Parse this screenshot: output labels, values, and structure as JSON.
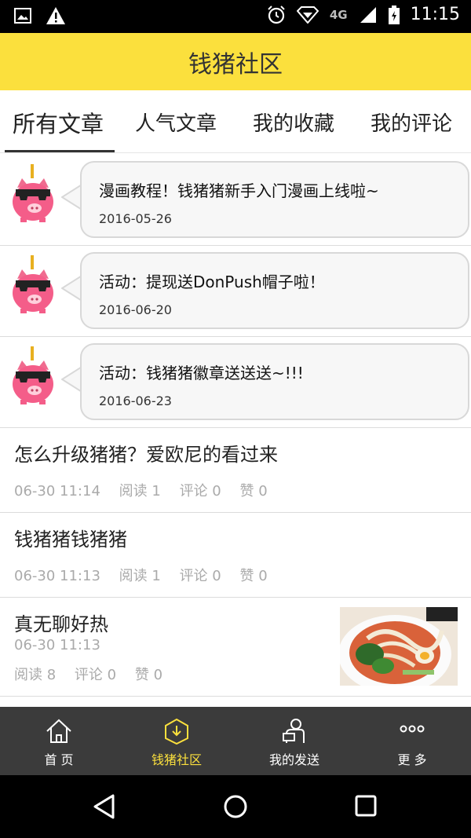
{
  "status_bar": {
    "time": "11:15",
    "network": "4G"
  },
  "header": {
    "title": "钱猪社区"
  },
  "tabs": [
    {
      "label": "所有文章",
      "active": true
    },
    {
      "label": "人气文章",
      "active": false
    },
    {
      "label": "我的收藏",
      "active": false
    },
    {
      "label": "我的评论",
      "active": false
    }
  ],
  "announcements": [
    {
      "title": "漫画教程！钱猪猪新手入门漫画上线啦~",
      "date": "2016-05-26"
    },
    {
      "title": "活动：提现送DonPush帽子啦！",
      "date": "2016-06-20"
    },
    {
      "title": "活动：钱猪猪徽章送送送~!!!",
      "date": "2016-06-23"
    }
  ],
  "posts": [
    {
      "title": "怎么升级猪猪？爱欧尼的看过来",
      "time": "06-30 11:14",
      "reads": "阅读 1",
      "comments": "评论 0",
      "likes": "赞 0"
    },
    {
      "title": "钱猪猪钱猪猪",
      "time": "06-30 11:13",
      "reads": "阅读 1",
      "comments": "评论 0",
      "likes": "赞 0"
    },
    {
      "title": "真无聊好热",
      "time": "06-30 11:13",
      "reads": "阅读 8",
      "comments": "评论 0",
      "likes": "赞 0",
      "has_image": true
    }
  ],
  "bottom_nav": [
    {
      "label": "首 页",
      "icon": "home-icon",
      "active": false
    },
    {
      "label": "钱猪社区",
      "icon": "community-icon",
      "active": true
    },
    {
      "label": "我的发送",
      "icon": "person-send-icon",
      "active": false
    },
    {
      "label": "更 多",
      "icon": "more-icon",
      "active": false
    }
  ],
  "colors": {
    "accent": "#fbe03d",
    "nav_bg": "#3b3b3b",
    "meta": "#aaaaaa"
  }
}
